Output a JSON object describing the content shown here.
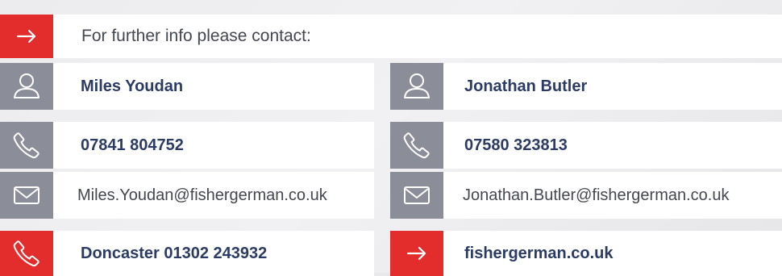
{
  "header": {
    "label": "For further info please contact:",
    "icon": "arrow-right-icon"
  },
  "contacts": [
    {
      "name": "Miles Youdan",
      "phone": "07841 804752",
      "email": "Miles.Youdan@fishergerman.co.uk"
    },
    {
      "name": "Jonathan Butler",
      "phone": "07580 323813",
      "email": "Jonathan.Butler@fishergerman.co.uk"
    }
  ],
  "footer": {
    "office": "Doncaster 01302 243932",
    "website": "fishergerman.co.uk"
  },
  "colors": {
    "red": "#e32d2d",
    "grey": "#8b8d98",
    "navy": "#2b3b63",
    "background": "#ececee"
  },
  "icons": {
    "person": "person-icon",
    "phone": "phone-icon",
    "email": "mail-icon",
    "arrow": "arrow-right-icon"
  }
}
